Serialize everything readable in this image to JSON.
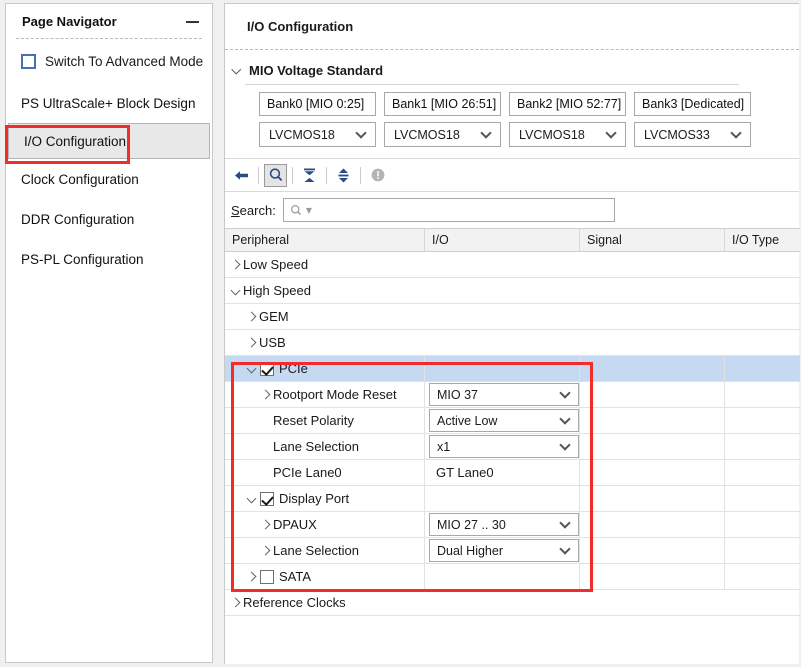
{
  "nav": {
    "title": "Page Navigator",
    "minimize_icon": "minimize-icon",
    "advanced_mode_label": "Switch To Advanced Mode",
    "advanced_mode_checked": false,
    "items": [
      {
        "label": "PS UltraScale+ Block Design",
        "selected": false
      },
      {
        "label": "I/O Configuration",
        "selected": true
      },
      {
        "label": "Clock Configuration",
        "selected": false
      },
      {
        "label": "DDR Configuration",
        "selected": false
      },
      {
        "label": "PS-PL Configuration",
        "selected": false
      }
    ]
  },
  "content": {
    "title": "I/O Configuration",
    "mio": {
      "section_label": "MIO Voltage Standard",
      "expanded": true,
      "banks": [
        {
          "name": "Bank0 [MIO 0:25]",
          "voltage": "LVCMOS18"
        },
        {
          "name": "Bank1 [MIO 26:51]",
          "voltage": "LVCMOS18"
        },
        {
          "name": "Bank2 [MIO 52:77]",
          "voltage": "LVCMOS18"
        },
        {
          "name": "Bank3 [Dedicated]",
          "voltage": "LVCMOS33"
        }
      ]
    },
    "toolbar": [
      {
        "icon": "back-arrow-icon",
        "active": false,
        "enabled": true
      },
      {
        "icon": "search-icon",
        "active": true,
        "enabled": true
      },
      {
        "icon": "collapse-all-icon",
        "active": false,
        "enabled": true
      },
      {
        "icon": "expand-all-icon",
        "active": false,
        "enabled": true
      },
      {
        "icon": "info-icon",
        "active": false,
        "enabled": false
      }
    ],
    "search": {
      "label": "Search:",
      "label_mnemonic": "S",
      "value": "",
      "placeholder_icon": "search-magnifier-icon"
    },
    "table": {
      "columns": [
        "Peripheral",
        "I/O",
        "Signal",
        "I/O Type"
      ],
      "rows": [
        {
          "indent": 0,
          "twisty": "right",
          "label": "Low Speed",
          "kind": "group"
        },
        {
          "indent": 0,
          "twisty": "down",
          "label": "High Speed",
          "kind": "group"
        },
        {
          "indent": 1,
          "twisty": "right",
          "label": "GEM",
          "kind": "group"
        },
        {
          "indent": 1,
          "twisty": "right",
          "label": "USB",
          "kind": "group"
        },
        {
          "indent": 1,
          "twisty": "down",
          "checkbox": true,
          "checked": true,
          "label": "PCIe",
          "kind": "node",
          "selected": true
        },
        {
          "indent": 2,
          "twisty": "right",
          "label": "Rootport Mode Reset",
          "kind": "leaf",
          "io_type": "select",
          "io_value": "MIO 37"
        },
        {
          "indent": 2,
          "twisty": "none",
          "label": "Reset Polarity",
          "kind": "leaf",
          "io_type": "select",
          "io_value": "Active Low"
        },
        {
          "indent": 2,
          "twisty": "none",
          "label": "Lane Selection",
          "kind": "leaf",
          "io_type": "select",
          "io_value": "x1"
        },
        {
          "indent": 2,
          "twisty": "none",
          "label": "PCIe Lane0",
          "kind": "leaf",
          "io_type": "text",
          "io_value": "GT Lane0"
        },
        {
          "indent": 1,
          "twisty": "down",
          "checkbox": true,
          "checked": true,
          "label": "Display Port",
          "kind": "node"
        },
        {
          "indent": 2,
          "twisty": "right",
          "label": "DPAUX",
          "kind": "leaf",
          "io_type": "select",
          "io_value": "MIO 27 .. 30"
        },
        {
          "indent": 2,
          "twisty": "right",
          "label": "Lane Selection",
          "kind": "leaf",
          "io_type": "select",
          "io_value": "Dual Higher"
        },
        {
          "indent": 1,
          "twisty": "right",
          "checkbox": true,
          "checked": false,
          "label": "SATA",
          "kind": "node"
        },
        {
          "indent": 0,
          "twisty": "right",
          "label": "Reference Clocks",
          "kind": "group"
        }
      ]
    }
  },
  "annotations": {
    "highlight_color": "#f22c2c",
    "boxes": [
      {
        "name": "io-configuration-nav-highlight"
      },
      {
        "name": "pcie-displayport-tree-highlight"
      }
    ]
  }
}
